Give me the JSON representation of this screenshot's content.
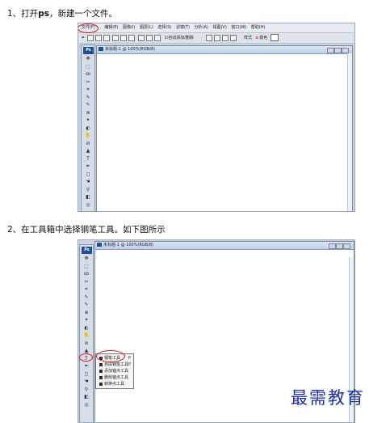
{
  "steps": [
    {
      "prefix": "1、打开",
      "bold": "ps",
      "suffix": "，新建一个文件。"
    },
    {
      "text": "2、在工具箱中选择钢笔工具。如下图所示"
    }
  ],
  "shot1": {
    "menu": [
      "文件(F)",
      "编辑(E)",
      "图像(I)",
      "图层(L)",
      "选择(S)",
      "滤镜(T)",
      "分析(A)",
      "视图(V)",
      "窗口(W)",
      "帮助(H)"
    ],
    "options": {
      "auto_add": "自动添加/删除",
      "style_label": "样式",
      "color_label": "颜色"
    },
    "toolbox_label": "Ps",
    "doc_title": "未标题-1 @ 100%(RGB/8)"
  },
  "shot2": {
    "toolbox_label": "Ps",
    "doc_title": "未标题-1 @ 100%(RGB/8)",
    "flyout": [
      {
        "label": "钢笔工具",
        "key": "P"
      },
      {
        "label": "自由钢笔工具",
        "key": "P"
      },
      {
        "label": "添加锚点工具",
        "key": ""
      },
      {
        "label": "删除锚点工具",
        "key": ""
      },
      {
        "label": "转换点工具",
        "key": ""
      }
    ]
  },
  "watermark": "最需教育",
  "colors": {
    "highlight": "#dd1111",
    "ps_blue": "#1d4f9a",
    "watermark": "#1c2fa8"
  }
}
